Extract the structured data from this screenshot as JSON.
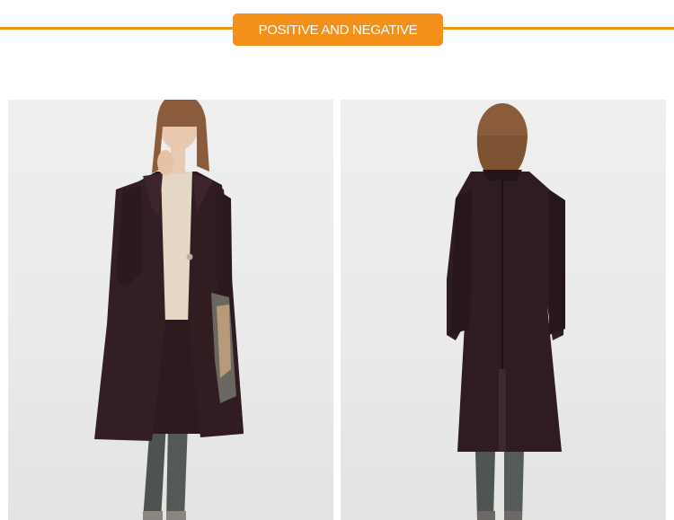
{
  "header": {
    "title": "POSITIVE AND NEGATIVE",
    "accent_color": "#f39019"
  },
  "photos": [
    {
      "name": "front-view",
      "subject": "model wearing long dark burgundy wool coat, front view"
    },
    {
      "name": "back-view",
      "subject": "model wearing long dark burgundy wool coat, back view"
    }
  ]
}
